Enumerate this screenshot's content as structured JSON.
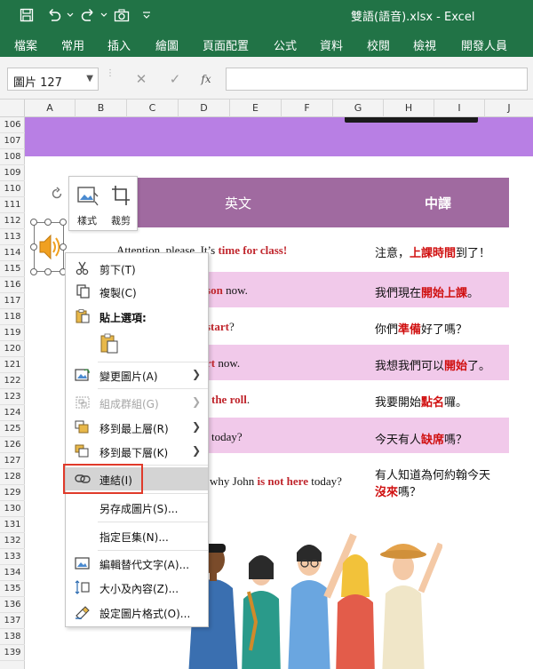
{
  "window": {
    "title": "雙語(語音).xlsx  -  Excel",
    "accent": "#217346"
  },
  "ribbon": {
    "tabs": [
      "檔案",
      "常用",
      "插入",
      "繪圖",
      "頁面配置",
      "公式",
      "資料",
      "校閱",
      "檢視",
      "開發人員"
    ]
  },
  "formula_bar": {
    "name_box": "圖片 127",
    "cancel": "✕",
    "enter": "✓",
    "fx": "fx",
    "value": ""
  },
  "columns": [
    "A",
    "B",
    "C",
    "D",
    "E",
    "F",
    "G",
    "H",
    "I",
    "J"
  ],
  "rows": [
    "106",
    "107",
    "108",
    "109",
    "110",
    "111",
    "112",
    "113",
    "114",
    "115",
    "116",
    "117",
    "118",
    "119",
    "120",
    "121",
    "122",
    "123",
    "124",
    "125",
    "126",
    "127",
    "128",
    "129",
    "130",
    "131",
    "132",
    "133",
    "134",
    "135",
    "136",
    "137",
    "138",
    "139"
  ],
  "table": {
    "header_en": "英文",
    "header_zh": "中譯",
    "header_color": "#a06aa0",
    "zebra_color": "#f1c9ea",
    "highlight_color": "#d01010",
    "lines": [
      {
        "en_pre": "Attention, please. It’s ",
        "en_hi": "time for class!",
        "en_post": "",
        "zh_pre": "注意，",
        "zh_hi": "上課時間",
        "zh_post": "到了！"
      },
      {
        "en_pre": "",
        "en_hi": "sson",
        "en_post": " now.",
        "zh_pre": "我們現在",
        "zh_hi": "開始上課",
        "zh_post": "。"
      },
      {
        "en_pre": "",
        "en_hi": "start",
        "en_post": "?",
        "zh_pre": "你們",
        "zh_hi": "準備",
        "zh_post": "好了嗎？"
      },
      {
        "en_pre": "",
        "en_hi": "rt",
        "en_post": " now.",
        "zh_pre": "我想我們可以",
        "zh_hi": "開始",
        "zh_post": "了。"
      },
      {
        "en_pre": "",
        "en_hi": "the roll",
        "en_post": ".",
        "zh_pre": "我要開始",
        "zh_hi": "點名",
        "zh_post": "囉。"
      },
      {
        "en_pre": "today?",
        "en_hi": "",
        "en_post": "",
        "zh_pre": "今天有人",
        "zh_hi": "缺席",
        "zh_post": "嗎？"
      },
      {
        "en_pre": "why John ",
        "en_hi": "is not here",
        "en_post": " today?",
        "zh_pre": "有人知道為何約翰今天",
        "zh_hi": "",
        "zh_post": ""
      }
    ],
    "line7_zh2_hi": "沒來",
    "line7_zh2_post": "嗎？"
  },
  "mini_toolbar": {
    "style_label": "樣式",
    "crop_label": "裁剪"
  },
  "context_menu": {
    "items": [
      {
        "label": "剪下(T)",
        "icon": "scissors-icon",
        "enabled": true
      },
      {
        "label": "複製(C)",
        "icon": "copy-icon",
        "enabled": true
      },
      {
        "label": "貼上選項:",
        "icon": "paste-icon",
        "enabled": true
      },
      {
        "label": "變更圖片(A)",
        "icon": "change-picture-icon",
        "enabled": true
      },
      {
        "label": "組成群組(G)",
        "icon": "group-icon",
        "enabled": false
      },
      {
        "label": "移到最上層(R)",
        "icon": "bring-front-icon",
        "enabled": true
      },
      {
        "label": "移到最下層(K)",
        "icon": "send-back-icon",
        "enabled": true
      },
      {
        "label": "連結(I)",
        "icon": "link-icon",
        "enabled": true
      },
      {
        "label": "另存成圖片(S)...",
        "icon": "",
        "enabled": true
      },
      {
        "label": "指定巨集(N)...",
        "icon": "",
        "enabled": true
      },
      {
        "label": "編輯替代文字(A)...",
        "icon": "alt-text-icon",
        "enabled": true
      },
      {
        "label": "大小及內容(Z)...",
        "icon": "size-icon",
        "enabled": true
      },
      {
        "label": "設定圖片格式(O)...",
        "icon": "format-picture-icon",
        "enabled": true
      }
    ]
  }
}
